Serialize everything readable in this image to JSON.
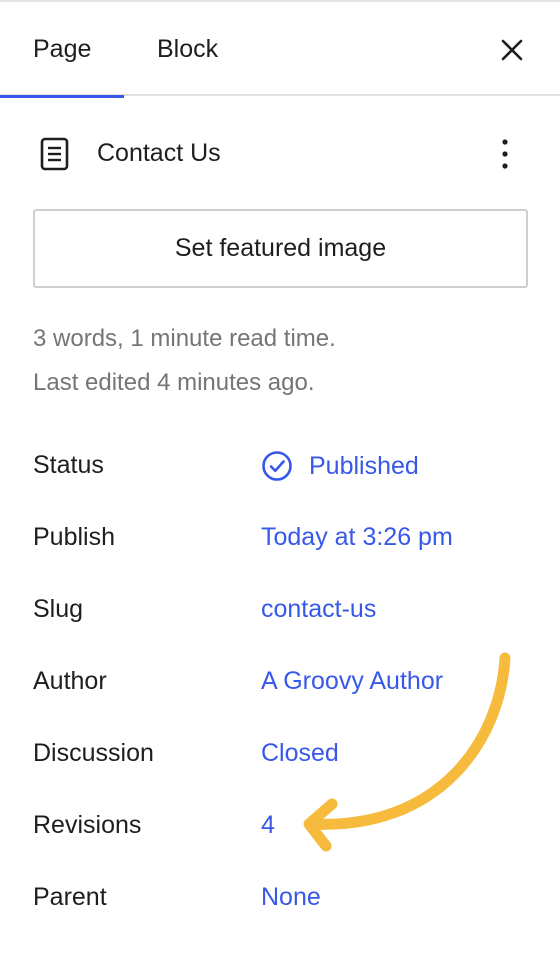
{
  "tabs": [
    {
      "label": "Page",
      "active": true
    },
    {
      "label": "Block",
      "active": false
    }
  ],
  "icons": {
    "close": "close-icon",
    "page": "page-document-icon",
    "more": "more-vertical-icon",
    "status": "check-circle-icon",
    "annotation": "curved-arrow-icon"
  },
  "document": {
    "title": "Contact Us",
    "featured_image_label": "Set featured image",
    "word_count_text": "3 words, 1 minute read time.",
    "last_edited_text": "Last edited 4 minutes ago."
  },
  "settings": [
    {
      "label": "Status",
      "value": "Published"
    },
    {
      "label": "Publish",
      "value": "Today at 3:26 pm"
    },
    {
      "label": "Slug",
      "value": "contact-us"
    },
    {
      "label": "Author",
      "value": "A Groovy Author"
    },
    {
      "label": "Discussion",
      "value": "Closed"
    },
    {
      "label": "Revisions",
      "value": "4"
    },
    {
      "label": "Parent",
      "value": "None"
    }
  ],
  "colors": {
    "accent": "#3858e9",
    "annotation": "#f6bb3c",
    "muted_text": "#757575"
  }
}
